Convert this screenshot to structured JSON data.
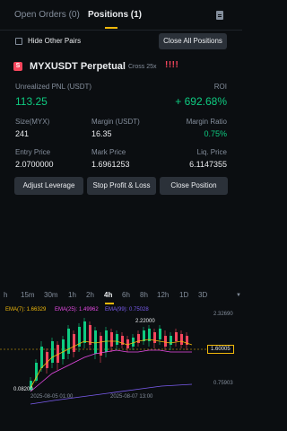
{
  "tabs": {
    "open_orders": "Open Orders (0)",
    "positions": "Positions (1)"
  },
  "filter": {
    "hide_other_pairs": "Hide Other Pairs",
    "close_all": "Close All Positions"
  },
  "position": {
    "badge": "S",
    "symbol": "MYXUSDT Perpetual",
    "mode": "Cross 25x",
    "warning": "!!!!",
    "unrealized_pnl_label": "Unrealized PNL (USDT)",
    "unrealized_pnl": "113.25",
    "roi_label": "ROI",
    "roi": "+ 692.68%",
    "size_label": "Size(MYX)",
    "size": "241",
    "margin_label": "Margin (USDT)",
    "margin": "16.35",
    "margin_ratio_label": "Margin Ratio",
    "margin_ratio": "0.75%",
    "entry_label": "Entry Price",
    "entry": "2.0700000",
    "mark_label": "Mark Price",
    "mark": "1.6961253",
    "liq_label": "Liq. Price",
    "liq": "6.1147355"
  },
  "actions": {
    "adjust_leverage": "Adjust Leverage",
    "stop_profit_loss": "Stop Profit & Loss",
    "close_position": "Close Position"
  },
  "timeframes": [
    "h",
    "15m",
    "30m",
    "1h",
    "2h",
    "4h",
    "6h",
    "8h",
    "12h",
    "1D",
    "3D"
  ],
  "active_timeframe": "4h",
  "chart": {
    "ema7": "EMA(7): 1.66329",
    "ema25": "EMA(25): 1.49962",
    "ema99": "EMA(99): 0.75028",
    "price_levels": [
      "2.32690",
      "0.75903"
    ],
    "current_price": "1.60005",
    "high_annotation": "2.22000",
    "low_annotation": "0.08200",
    "dates": [
      "2025-08-05 01:00",
      "2025-08-07 13:00"
    ],
    "colors": {
      "up": "#0ecb81",
      "down": "#f6465d",
      "ema7": "#f0b90b",
      "ema25": "#e84ae6",
      "ema99": "#7b5cf0"
    }
  }
}
